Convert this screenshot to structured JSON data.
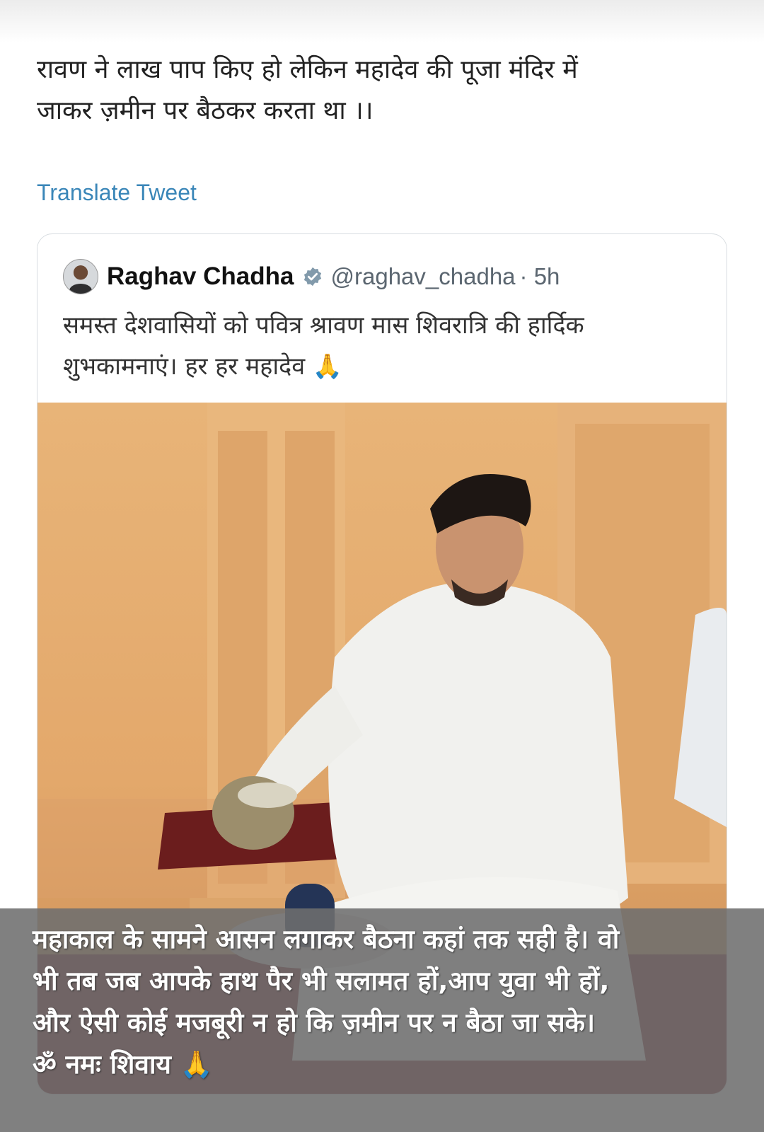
{
  "post": {
    "text_line1": "रावण ने लाख पाप किए हो लेकिन महादेव की पूजा मंदिर में",
    "text_line2": "जाकर ज़मीन पर बैठकर करता था ।।",
    "translate_label": "Translate Tweet"
  },
  "quoted_tweet": {
    "author_name": "Raghav Chadha",
    "handle": "@raghav_chadha",
    "time": "· 5h",
    "text_line1": "समस्त देशवासियों को पवित्र श्रावण मास शिवरात्रि की हार्दिक",
    "text_line2": "शुभकामनाएं। हर हर महादेव 🙏",
    "verified_color": "#829aab"
  },
  "overlay_caption": {
    "line1": "महाकाल के सामने आसन लगाकर बैठना कहां तक सही है। वो",
    "line2": "भी तब जब आपके हाथ पैर भी सलामत हों,आप युवा भी हों,",
    "line3": "और ऐसी कोई मजबूरी न हो कि ज़मीन पर न बैठा जा सके।",
    "line4": "ॐ नमः शिवाय 🙏"
  },
  "icons": [
    "avatar",
    "verified-badge-icon",
    "folded-hands-emoji"
  ],
  "colors": {
    "link": "#3a86b8",
    "handle": "#5b6670",
    "caption_bg": "#6e6e6e"
  }
}
